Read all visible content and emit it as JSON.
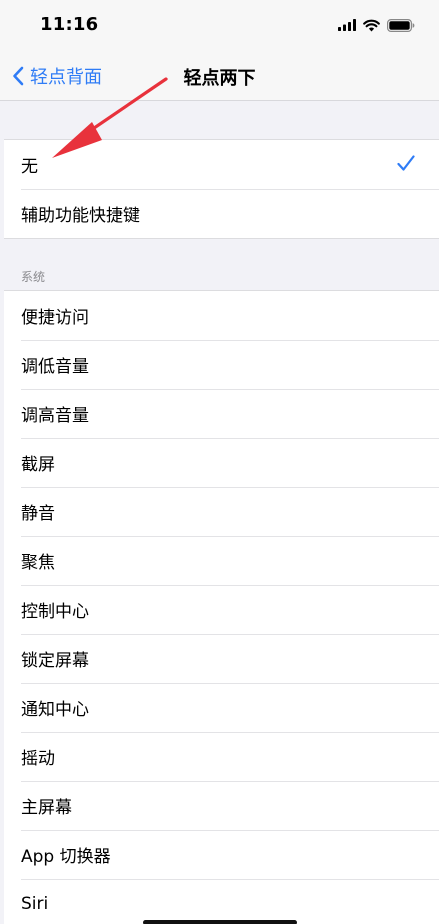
{
  "status_bar": {
    "time": "11:16"
  },
  "nav": {
    "back_label": "轻点背面",
    "title": "轻点两下"
  },
  "top_group": [
    {
      "label": "无",
      "checked": true
    },
    {
      "label": "辅助功能快捷键",
      "checked": false
    }
  ],
  "section_header": "系统",
  "system_group": [
    {
      "label": "便捷访问"
    },
    {
      "label": "调低音量"
    },
    {
      "label": "调高音量"
    },
    {
      "label": "截屏"
    },
    {
      "label": "静音"
    },
    {
      "label": "聚焦"
    },
    {
      "label": "控制中心"
    },
    {
      "label": "锁定屏幕"
    },
    {
      "label": "通知中心"
    },
    {
      "label": "摇动"
    },
    {
      "label": "主屏幕"
    },
    {
      "label": "App 切换器"
    },
    {
      "label": "Siri"
    }
  ],
  "colors": {
    "accent": "#2f7cf6",
    "annotation_arrow": "#e8323c",
    "background": "#f2f2f7"
  }
}
